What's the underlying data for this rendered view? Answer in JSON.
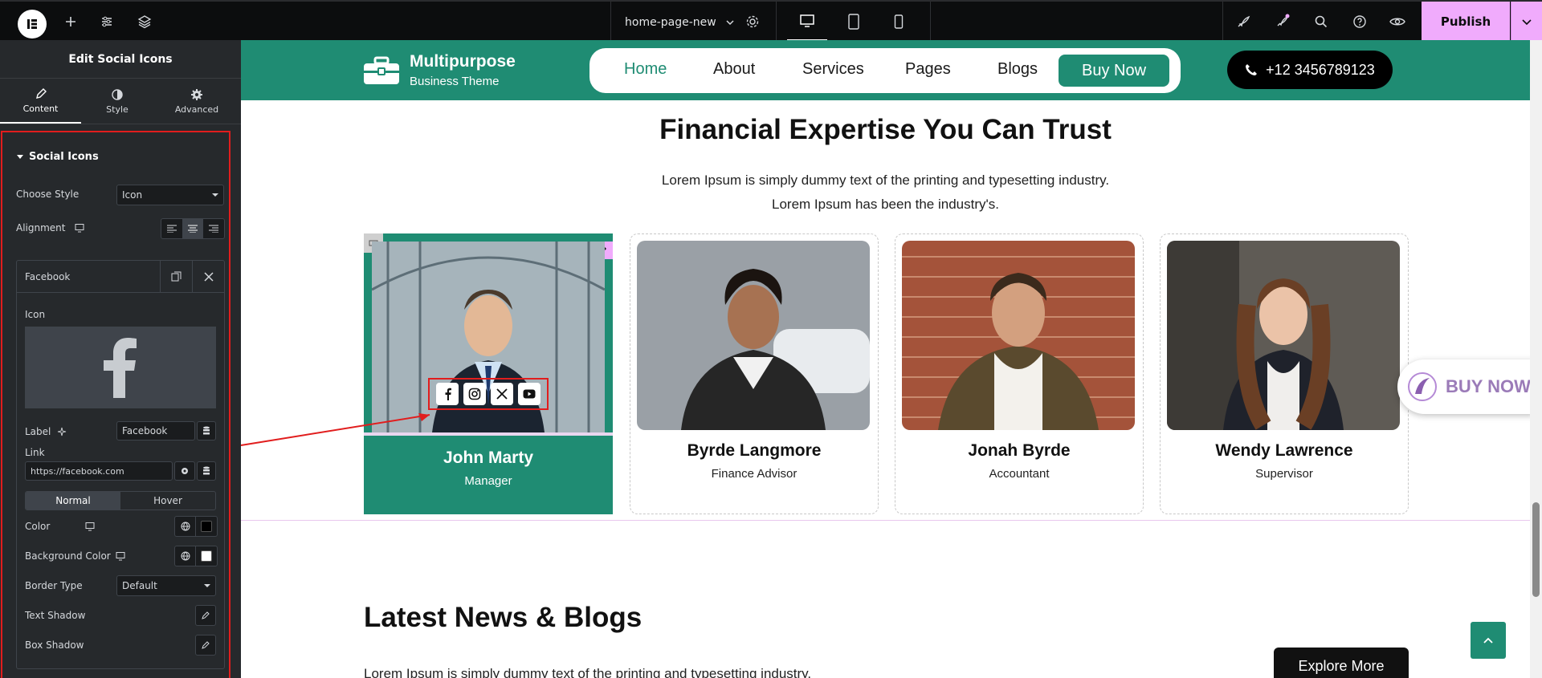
{
  "topbar": {
    "page_name": "home-page-new",
    "publish_label": "Publish"
  },
  "sidebar": {
    "title": "Edit Social Icons",
    "tabs": [
      {
        "label": "Content",
        "icon": "pencil-icon"
      },
      {
        "label": "Style",
        "icon": "half-circle-icon"
      },
      {
        "label": "Advanced",
        "icon": "gear-icon"
      }
    ],
    "section_title": "Social Icons",
    "choose_style_label": "Choose Style",
    "choose_style_value": "Icon",
    "alignment_label": "Alignment",
    "item_title": "Facebook",
    "icon_label": "Icon",
    "label_label": "Label",
    "label_value": "Facebook",
    "link_label": "Link",
    "link_value": "https://facebook.com",
    "state_tabs": [
      "Normal",
      "Hover"
    ],
    "color_label": "Color",
    "color_swatch": "#000000",
    "bg_color_label": "Background Color",
    "bg_color_swatch": "#ffffff",
    "border_type_label": "Border Type",
    "border_type_value": "Default",
    "text_shadow_label": "Text Shadow",
    "box_shadow_label": "Box Shadow"
  },
  "site": {
    "brand_name": "Multipurpose",
    "brand_tagline": "Business Theme",
    "nav": [
      "Home",
      "About",
      "Services",
      "Pages",
      "Blogs"
    ],
    "buy_now_nav": "Buy Now",
    "phone": "+12 3456789123",
    "heading": "Financial Expertise You Can Trust",
    "sub_line1": "Lorem Ipsum is simply dummy text of the printing and typesetting industry.",
    "sub_line2": "Lorem Ipsum has been the industry's.",
    "team": [
      {
        "name": "John Marty",
        "role": "Manager"
      },
      {
        "name": "Byrde Langmore",
        "role": "Finance Advisor"
      },
      {
        "name": "Jonah Byrde",
        "role": "Accountant"
      },
      {
        "name": "Wendy Lawrence",
        "role": "Supervisor"
      }
    ],
    "floating_buy_now": "BUY NOW",
    "blogs_heading": "Latest News & Blogs",
    "blogs_text": "Lorem Ipsum is simply dummy text of the printing and typesetting industry.",
    "explore_more": "Explore More"
  },
  "colors": {
    "brand_green": "#1f8c73",
    "publish_pink": "#f0abfc",
    "highlight_red": "#e11d1d"
  }
}
